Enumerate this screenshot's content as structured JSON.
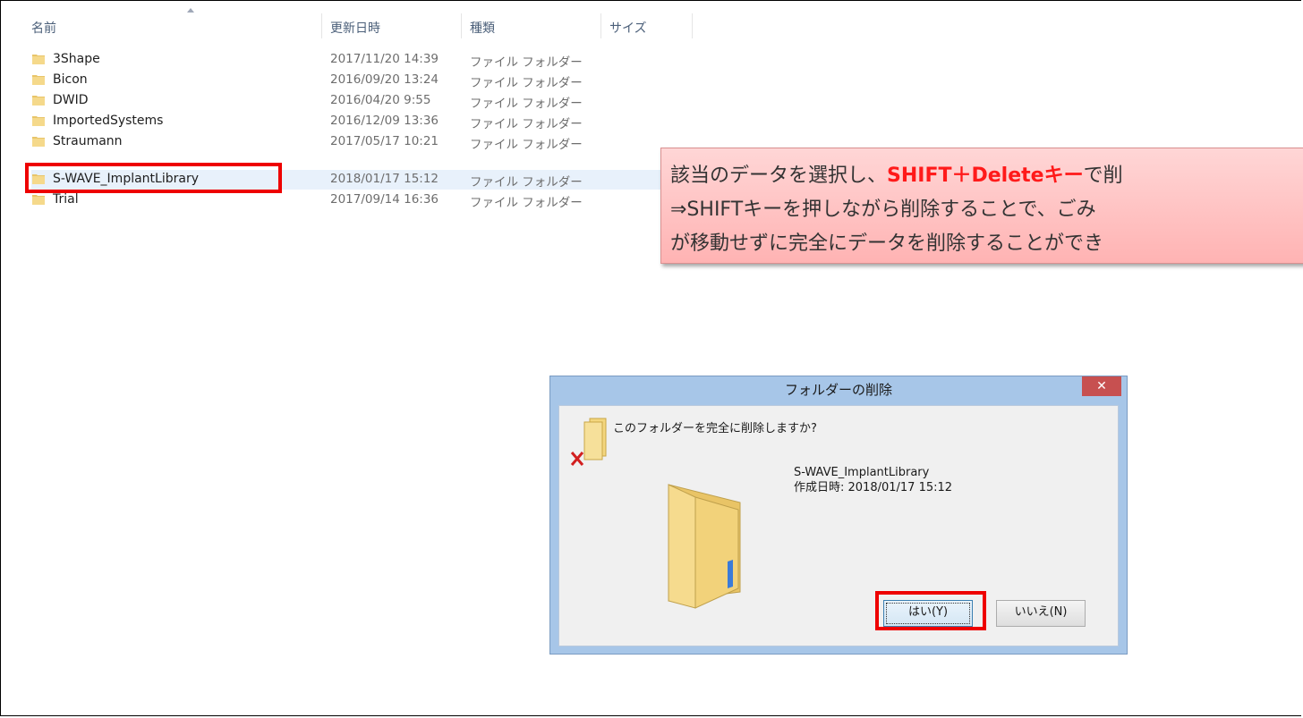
{
  "columns": {
    "name": "名前",
    "modified": "更新日時",
    "type": "種類",
    "size": "サイズ"
  },
  "rows": [
    {
      "name": "3Shape",
      "date": "2017/11/20 14:39",
      "type": "ファイル フォルダー"
    },
    {
      "name": "Bicon",
      "date": "2016/09/20 13:24",
      "type": "ファイル フォルダー"
    },
    {
      "name": "DWID",
      "date": "2016/04/20 9:55",
      "type": "ファイル フォルダー"
    },
    {
      "name": "ImportedSystems",
      "date": "2016/12/09 13:36",
      "type": "ファイル フォルダー"
    },
    {
      "name": "Straumann",
      "date": "2017/05/17 10:21",
      "type": "ファイル フォルダー"
    },
    {
      "name": "S-WAVE_ImplantLibrary",
      "date": "2018/01/17 15:12",
      "type": "ファイル フォルダー"
    },
    {
      "name": "Trial",
      "date": "2017/09/14 16:36",
      "type": "ファイル フォルダー"
    }
  ],
  "callout": {
    "line1_pre": "該当のデータを選択し、",
    "line1_hl": "SHIFT＋Deleteキー",
    "line1_post": "で削",
    "line2": "⇒SHIFTキーを押しながら削除することで、ごみ",
    "line3": "が移動せずに完全にデータを削除することができ"
  },
  "dialog": {
    "title": "フォルダーの削除",
    "close": "✕",
    "question": "このフォルダーを完全に削除しますか?",
    "folder_name": "S-WAVE_ImplantLibrary",
    "created": "作成日時: 2018/01/17 15:12",
    "yes_label": "はい(Y)",
    "no_label": "いいえ(N)"
  },
  "colors": {
    "highlight_red": "#ee0000",
    "callout_text_red": "#ff1a1a",
    "dialog_frame": "#a7c6e8"
  }
}
